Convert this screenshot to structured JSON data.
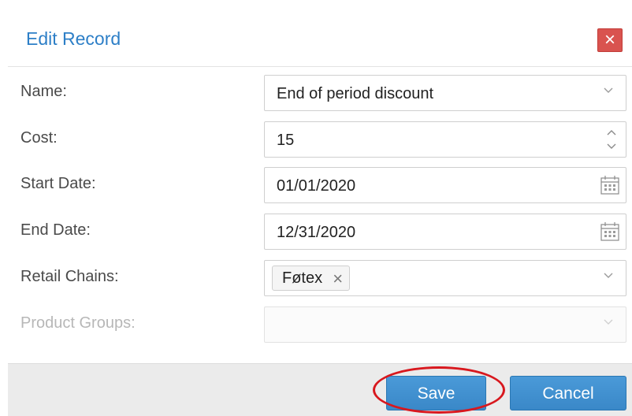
{
  "dialog": {
    "title": "Edit Record",
    "close_glyph": "×"
  },
  "fields": {
    "name": {
      "label": "Name:",
      "value": "End of period discount"
    },
    "cost": {
      "label": "Cost:",
      "value": "15"
    },
    "start_date": {
      "label": "Start Date:",
      "value": "01/01/2020"
    },
    "end_date": {
      "label": "End Date:",
      "value": "12/31/2020"
    },
    "retail_chains": {
      "label": "Retail Chains:",
      "tags": [
        "Føtex"
      ],
      "tag_remove_glyph": "×"
    },
    "product_groups": {
      "label": "Product Groups:",
      "value": "",
      "disabled": true
    }
  },
  "footer": {
    "save_label": "Save",
    "cancel_label": "Cancel"
  },
  "colors": {
    "title": "#2d7fc7",
    "close_button": "#d9534f",
    "primary_button": "#3a88c8",
    "highlight_ring": "#d8181e"
  },
  "icons": {
    "dropdown": "chevron-down-icon",
    "spinner": "spinner-arrows-icon",
    "calendar": "calendar-icon",
    "close": "close-icon"
  }
}
